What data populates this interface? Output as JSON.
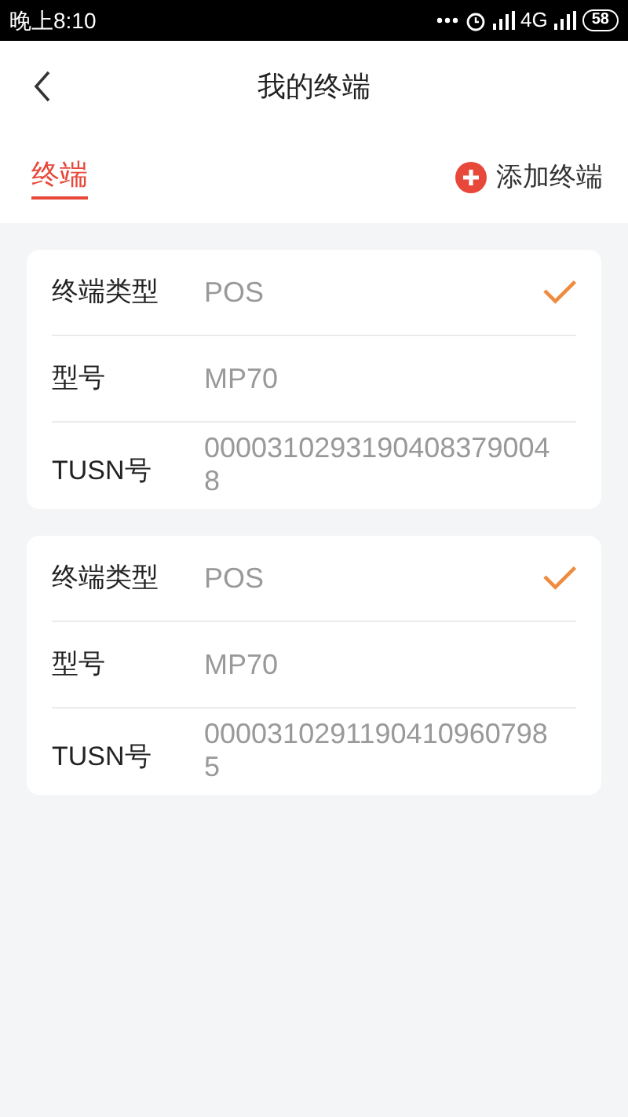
{
  "status_bar": {
    "time": "晚上8:10",
    "network": "4G",
    "battery": "58"
  },
  "header": {
    "title": "我的终端"
  },
  "tabs": [
    {
      "label": "终端",
      "selected": true
    }
  ],
  "add_button": {
    "label": "添加终端"
  },
  "terminals": [
    {
      "selected": true,
      "rows": [
        {
          "label": "终端类型",
          "value": "POS"
        },
        {
          "label": "型号",
          "value": "MP70"
        },
        {
          "label": "TUSN号",
          "value": "00003102931904083790048"
        }
      ]
    },
    {
      "selected": true,
      "rows": [
        {
          "label": "终端类型",
          "value": "POS"
        },
        {
          "label": "型号",
          "value": "MP70"
        },
        {
          "label": "TUSN号",
          "value": "00003102911904109607985"
        }
      ]
    }
  ]
}
